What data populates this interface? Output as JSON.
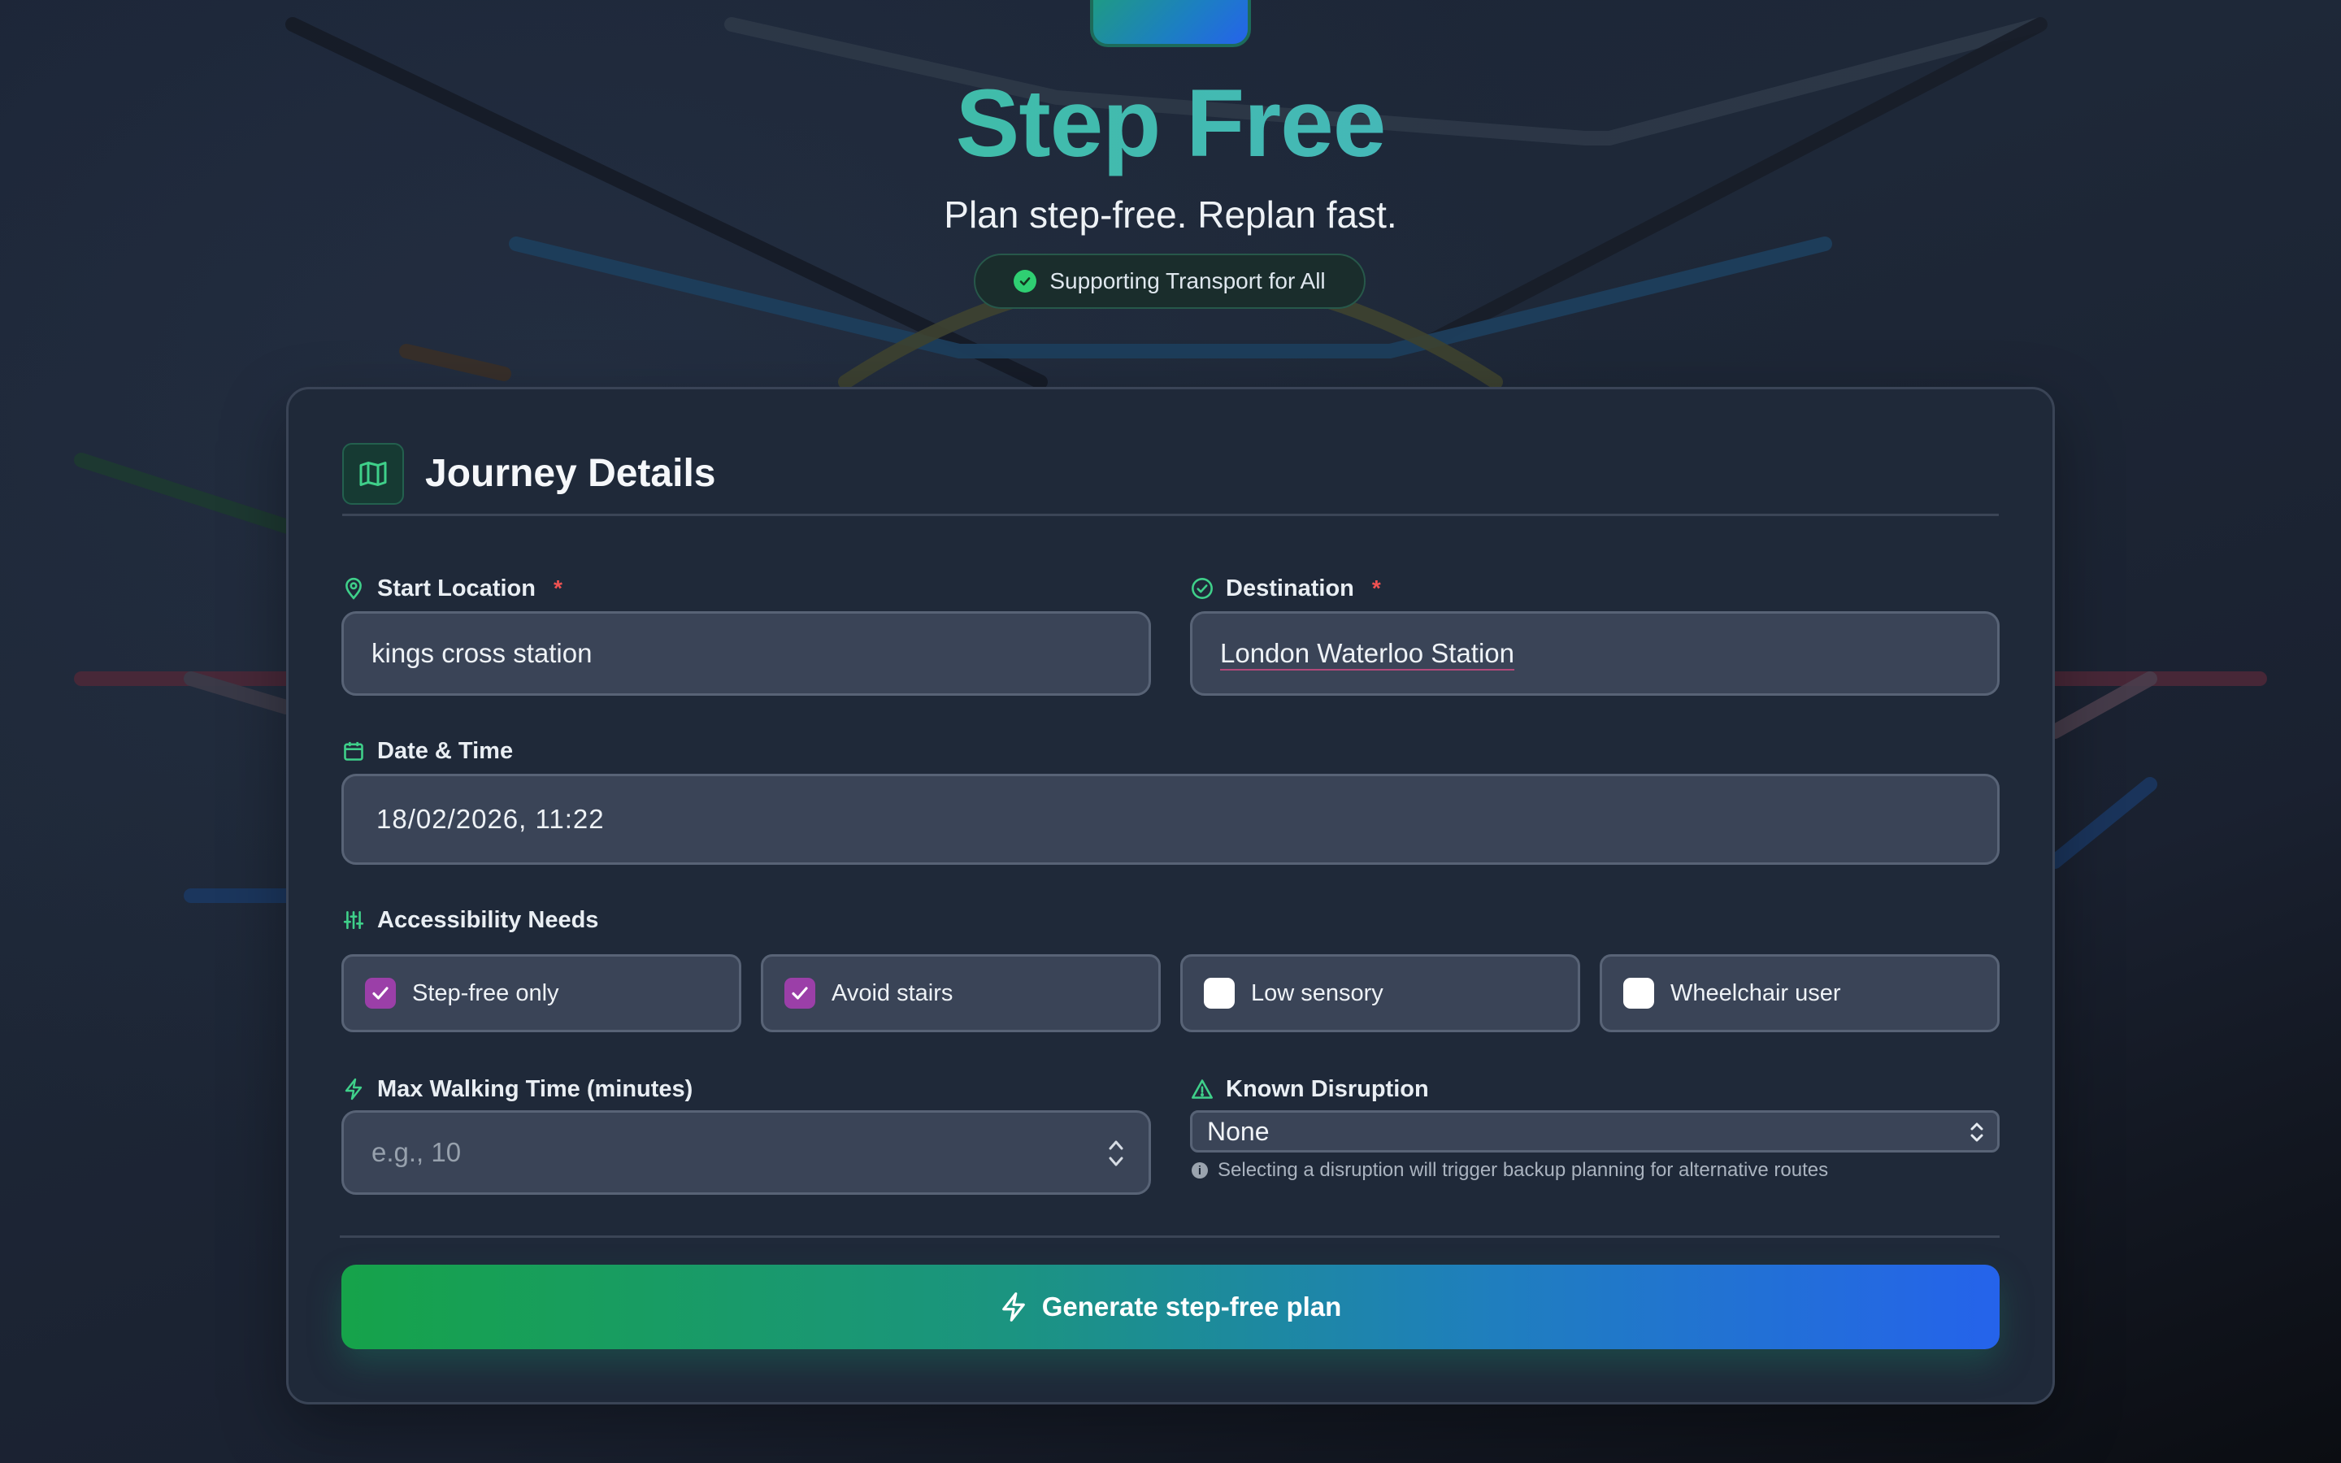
{
  "hero": {
    "title": "Step Free",
    "subtitle": "Plan step-free. Replan fast.",
    "badge": "Supporting Transport for All"
  },
  "form": {
    "title": "Journey Details",
    "start": {
      "label": "Start Location",
      "required_mark": "*",
      "value": "kings cross station"
    },
    "destination": {
      "label": "Destination",
      "required_mark": "*",
      "value": "London Waterloo Station"
    },
    "datetime": {
      "label": "Date & Time",
      "value": "18/02/2026, 11:22"
    },
    "accessibility": {
      "label": "Accessibility Needs",
      "options": [
        {
          "label": "Step-free only",
          "checked": true
        },
        {
          "label": "Avoid stairs",
          "checked": true
        },
        {
          "label": "Low sensory",
          "checked": false
        },
        {
          "label": "Wheelchair user",
          "checked": false
        }
      ]
    },
    "max_walking": {
      "label": "Max Walking Time (minutes)",
      "placeholder": "e.g., 10"
    },
    "disruption": {
      "label": "Known Disruption",
      "selected": "None",
      "help": "Selecting a disruption will trigger backup planning for alternative routes"
    },
    "submit_label": "Generate step-free plan"
  },
  "icons": {
    "header": "map-icon",
    "start": "map-pin-icon",
    "destination": "check-circle-icon",
    "datetime": "calendar-icon",
    "accessibility": "sliders-icon",
    "walking": "lightning-icon",
    "disruption": "warning-triangle-icon",
    "help": "info-icon",
    "submit": "lightning-icon"
  },
  "colors": {
    "accent_green": "#2fcf72",
    "checkbox_checked": "#9b3fa8",
    "required": "#f05252",
    "cta_start": "#16a34a",
    "cta_end": "#2563eb"
  }
}
